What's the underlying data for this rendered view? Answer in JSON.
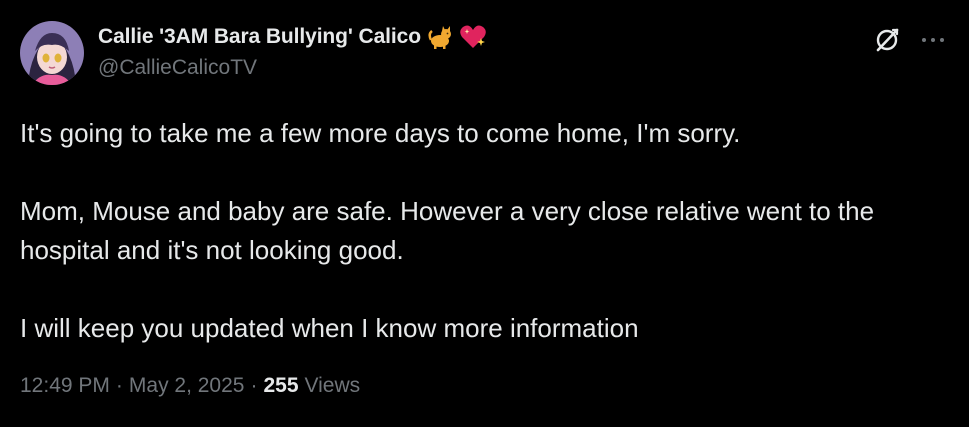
{
  "author": {
    "display_name": "Callie '3AM Bara Bullying' Calico",
    "handle": "@CallieCalicoTV",
    "name_emojis": [
      "cat-emoji",
      "sparkling-heart-emoji"
    ]
  },
  "header_icons": {
    "grok": "grok-icon",
    "more": "more-icon"
  },
  "tweet": {
    "line1": "It's going to take me a few more days to come home, I'm sorry.",
    "line2": "Mom, Mouse and baby are safe. However a very close relative went to the hospital and it's not looking good.",
    "line3": "I will keep you updated when I know more information"
  },
  "meta": {
    "time": "12:49 PM",
    "separator": "·",
    "date": "May 2, 2025",
    "views_count": "255",
    "views_label": "Views"
  },
  "colors": {
    "background": "#000000",
    "primary_text": "#e7e9ea",
    "secondary_text": "#71767b"
  }
}
